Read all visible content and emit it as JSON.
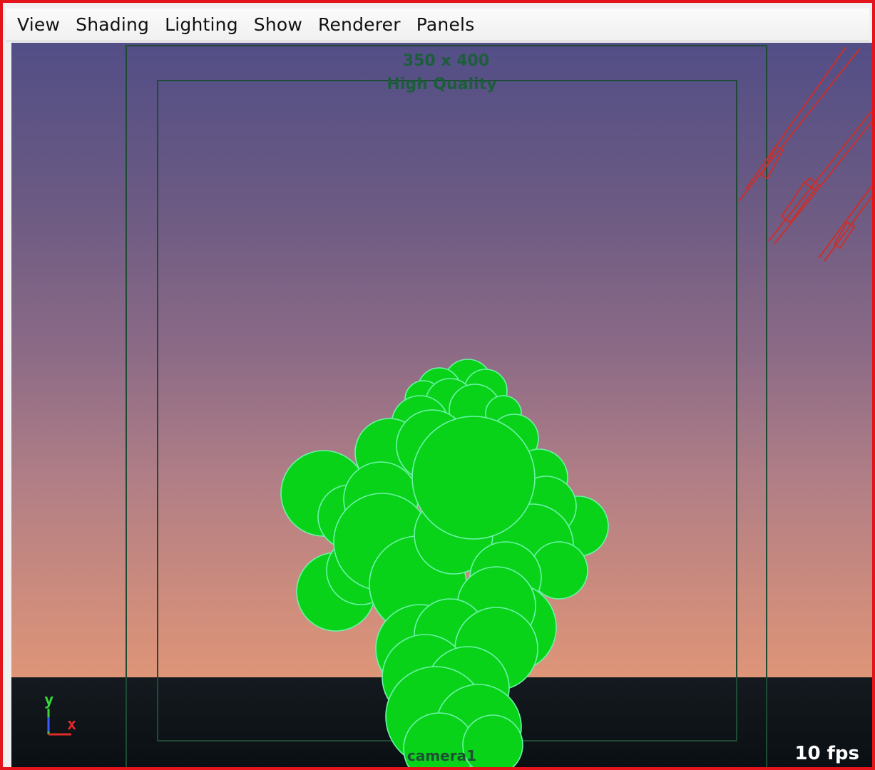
{
  "menu": {
    "items": [
      {
        "label": "View"
      },
      {
        "label": "Shading"
      },
      {
        "label": "Lighting"
      },
      {
        "label": "Show"
      },
      {
        "label": "Renderer"
      },
      {
        "label": "Panels"
      }
    ]
  },
  "viewport": {
    "resolution_label": "350 x 400",
    "quality_label": "High Quality",
    "camera_label": "camera1",
    "fps_label": "10 fps",
    "axis": {
      "y_label": "y",
      "x_label": "x"
    },
    "object": "particle-cloud",
    "colors": {
      "sky_top": "#524e86",
      "sky_bottom": "#e29a78",
      "ground": "#0f1519",
      "gate": "#1f4a34",
      "particles_fill": "#08d319",
      "particles_outline": "#6cf3a8",
      "lights": "#c8302c",
      "frame_border": "#e3141b"
    }
  }
}
